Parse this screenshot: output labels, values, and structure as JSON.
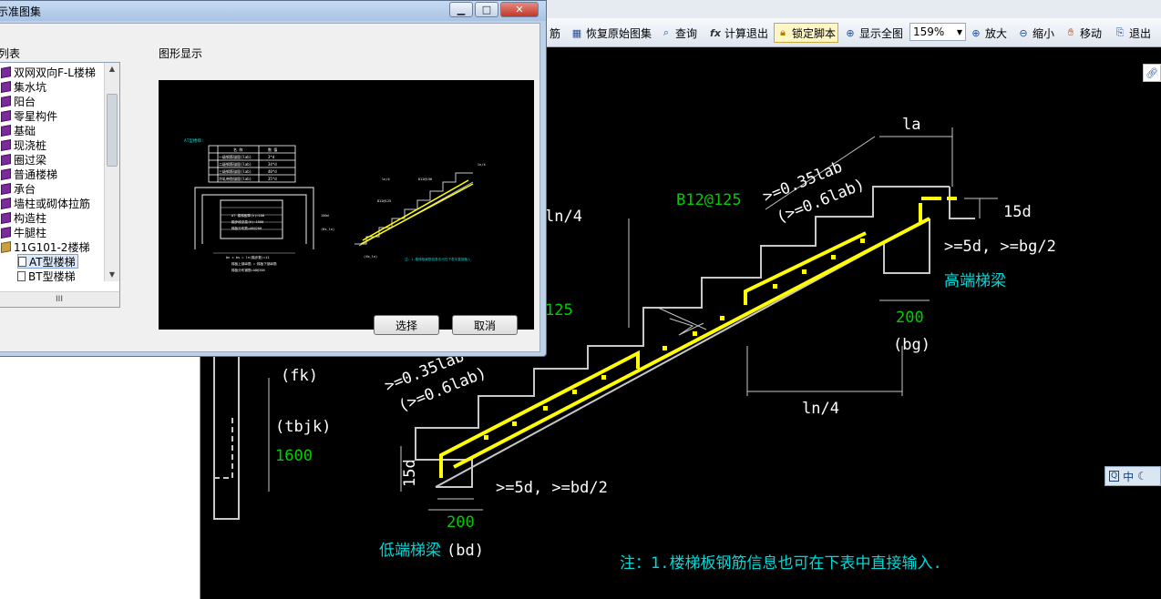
{
  "toolbar": {
    "clip_label": "筋",
    "restore_label": "恢复原始图集",
    "query_label": "查询",
    "calc_exit_label": "计算退出",
    "lock_label": "锁定脚本",
    "fit_label": "显示全图",
    "zoom_value": "159%",
    "zoom_in_label": "放大",
    "zoom_out_label": "缩小",
    "move_label": "移动",
    "exit_label": "退出"
  },
  "dialog": {
    "title": "示准图集",
    "list_title": "列表",
    "preview_title": "图形显示",
    "tree_items": [
      {
        "label": "双网双向F-L楼梯",
        "type": "book"
      },
      {
        "label": "集水坑",
        "type": "book"
      },
      {
        "label": "阳台",
        "type": "book"
      },
      {
        "label": "零星构件",
        "type": "book"
      },
      {
        "label": "基础",
        "type": "book"
      },
      {
        "label": "现浇桩",
        "type": "book"
      },
      {
        "label": "圈过梁",
        "type": "book"
      },
      {
        "label": "普通楼梯",
        "type": "book"
      },
      {
        "label": "承台",
        "type": "book"
      },
      {
        "label": "墙柱或砌体拉筋",
        "type": "book"
      },
      {
        "label": "构造柱",
        "type": "book"
      },
      {
        "label": "牛腿柱",
        "type": "book"
      },
      {
        "label": "11G101-2楼梯",
        "type": "folder"
      },
      {
        "label": "AT型楼梯",
        "type": "doc"
      },
      {
        "label": "BT型楼梯",
        "type": "doc"
      }
    ],
    "hscroll_label": "III",
    "select_button": "选择",
    "cancel_button": "取消",
    "preview": {
      "heading": "AT型楼梯:",
      "table_header": [
        "",
        "名 称",
        "数 值"
      ],
      "table_rows": [
        [
          "",
          "一级钢筋锚固(lab)",
          "3*d"
        ],
        [
          "",
          "二级钢筋锚固(lab)",
          "34*d"
        ],
        [
          "",
          "三级钢筋锚固(lab)",
          "40*d"
        ],
        [
          "",
          "冷轧带肋锚固(lab)",
          "35*d"
        ]
      ],
      "plan_lines": [
        "AT 楼梯板厚(h)=100",
        "踏步段总高(H)=1500",
        "梯板分布筋=A8@200"
      ],
      "plan_bottom": "bn × bs = ln(踏步数)=11",
      "plan_bottom2": "梯板上部纵筋 = 梯板下部纵筋",
      "plan_bottom3": "梯板分布钢筋=A8@200",
      "elev_labels": [
        "D12@150",
        "D12@125",
        "ln/4",
        "ln/4",
        "150d",
        "(Hs_ln)",
        "(tb_ln)"
      ],
      "note": "注：1.楼梯板钢筋信息也可在下表中直接输入."
    }
  },
  "canvas": {
    "labels": {
      "la": "la",
      "top_anchor1": ">=0.35lab",
      "top_anchor2": "(>=0.6lab)",
      "rebar_top": "B12@125",
      "ln4_top": "ln/4",
      "d15_top": "15d",
      "gt5d_top": ">=5d, >=bg/2",
      "high_beam": "高端梯梁",
      "bg_val": "200",
      "bg": "(bg)",
      "rebar_mid": "125",
      "fk": "(fk)",
      "tbjk": "(tbjk)",
      "height": "1600",
      "low_anchor1": ">=0.35lab",
      "low_anchor2": "(>=0.6lab)",
      "ln4_bottom": "ln/4",
      "d15_bottom": "15d",
      "gt5d_bottom": ">=5d, >=bd/2",
      "bd_val": "200",
      "low_beam": "低端梯梁",
      "bd": "(bd)",
      "note": "注：1.楼梯板钢筋信息也可在下表中直接输入."
    },
    "colors": {
      "rebar": "#ffff00",
      "green": "#00cc00",
      "cyan": "#00d8d8",
      "white": "#ffffff"
    }
  },
  "ime": {
    "label": "中"
  }
}
